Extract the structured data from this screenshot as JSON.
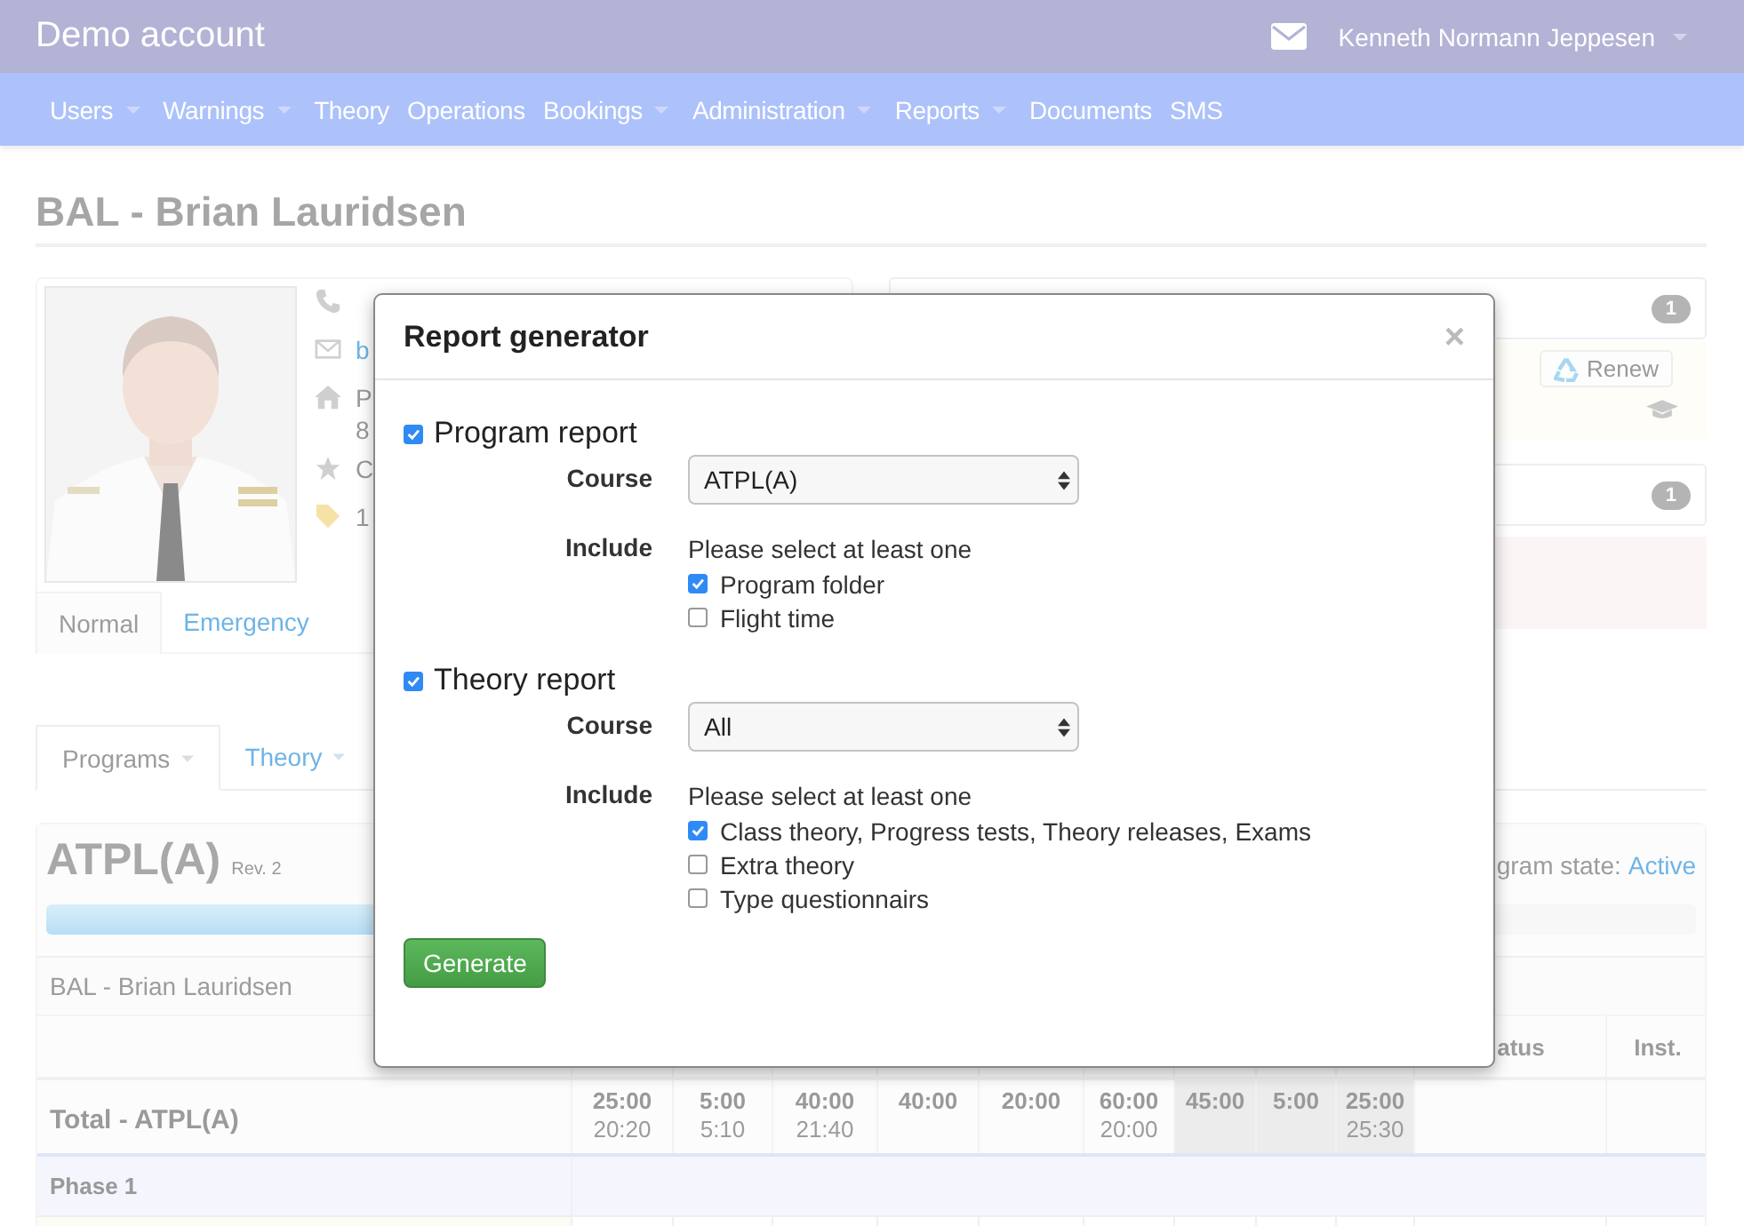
{
  "topbar": {
    "brand": "Demo account",
    "user": "Kenneth Normann Jeppesen"
  },
  "nav": [
    {
      "label": "Users",
      "dropdown": true
    },
    {
      "label": "Warnings",
      "dropdown": true
    },
    {
      "label": "Theory",
      "dropdown": false
    },
    {
      "label": "Operations",
      "dropdown": false
    },
    {
      "label": "Bookings",
      "dropdown": true
    },
    {
      "label": "Administration",
      "dropdown": true
    },
    {
      "label": "Reports",
      "dropdown": true
    },
    {
      "label": "Documents",
      "dropdown": false
    },
    {
      "label": "SMS",
      "dropdown": false
    }
  ],
  "page_title": "BAL - Brian Lauridsen",
  "profile": {
    "contacts": [
      {
        "kind": "phone"
      },
      {
        "kind": "email",
        "lines": [
          "b"
        ]
      },
      {
        "kind": "home",
        "lines": [
          "P",
          "8"
        ]
      },
      {
        "kind": "star",
        "lines": [
          "C"
        ]
      },
      {
        "kind": "tag",
        "lines": [
          "1"
        ]
      }
    ],
    "tabs": [
      {
        "label": "Normal",
        "selected": true
      },
      {
        "label": "Emergency",
        "selected": false
      }
    ]
  },
  "side_panels": [
    {
      "badge": "1",
      "kind": "warning",
      "button": "Renew"
    },
    {
      "badge": "1",
      "kind": "danger"
    }
  ],
  "program_tabs": [
    {
      "label": "Programs",
      "selected": true
    },
    {
      "label": "Theory",
      "selected": false
    }
  ],
  "program": {
    "title": "ATPL(A)",
    "revision": "Rev. 2",
    "state_label": "gram state:",
    "state": "Active",
    "level": 0.4,
    "student": "BAL - Brian Lauridsen",
    "headers": [
      "atus",
      "Inst."
    ],
    "total": {
      "label": "Total - ATPL(A)",
      "cells": [
        {
          "planned": "25:00",
          "actual": "20:20",
          "shaded": false
        },
        {
          "planned": "5:00",
          "actual": "5:10",
          "shaded": false
        },
        {
          "planned": "40:00",
          "actual": "21:40",
          "shaded": false
        },
        {
          "planned": "40:00",
          "shaded": false
        },
        {
          "planned": "20:00",
          "shaded": false
        },
        {
          "planned": "60:00",
          "actual": "20:00",
          "shaded": false
        },
        {
          "planned": "45:00",
          "shaded": true
        },
        {
          "planned": "5:00",
          "shaded": true
        },
        {
          "planned": "25:00",
          "actual": "25:30",
          "shaded": true
        },
        {},
        {}
      ]
    },
    "phase": "Phase 1"
  },
  "dialog": {
    "title": "Report generator",
    "close": "×",
    "sections": [
      {
        "label": "Program report",
        "checked": true,
        "course_label": "Course",
        "course": "ATPL(A)",
        "include_label": "Include",
        "hint": "Please select at least one",
        "options": [
          {
            "label": "Program folder",
            "checked": true
          },
          {
            "label": "Flight time",
            "checked": false
          }
        ]
      },
      {
        "label": "Theory report",
        "checked": true,
        "course_label": "Course",
        "course": "All",
        "include_label": "Include",
        "hint": "Please select at least one",
        "options": [
          {
            "label": "Class theory, Progress tests, Theory releases, Exams",
            "checked": true
          },
          {
            "label": "Extra theory",
            "checked": false
          },
          {
            "label": "Type questionnairs",
            "checked": false
          }
        ]
      }
    ],
    "button": "Generate"
  }
}
